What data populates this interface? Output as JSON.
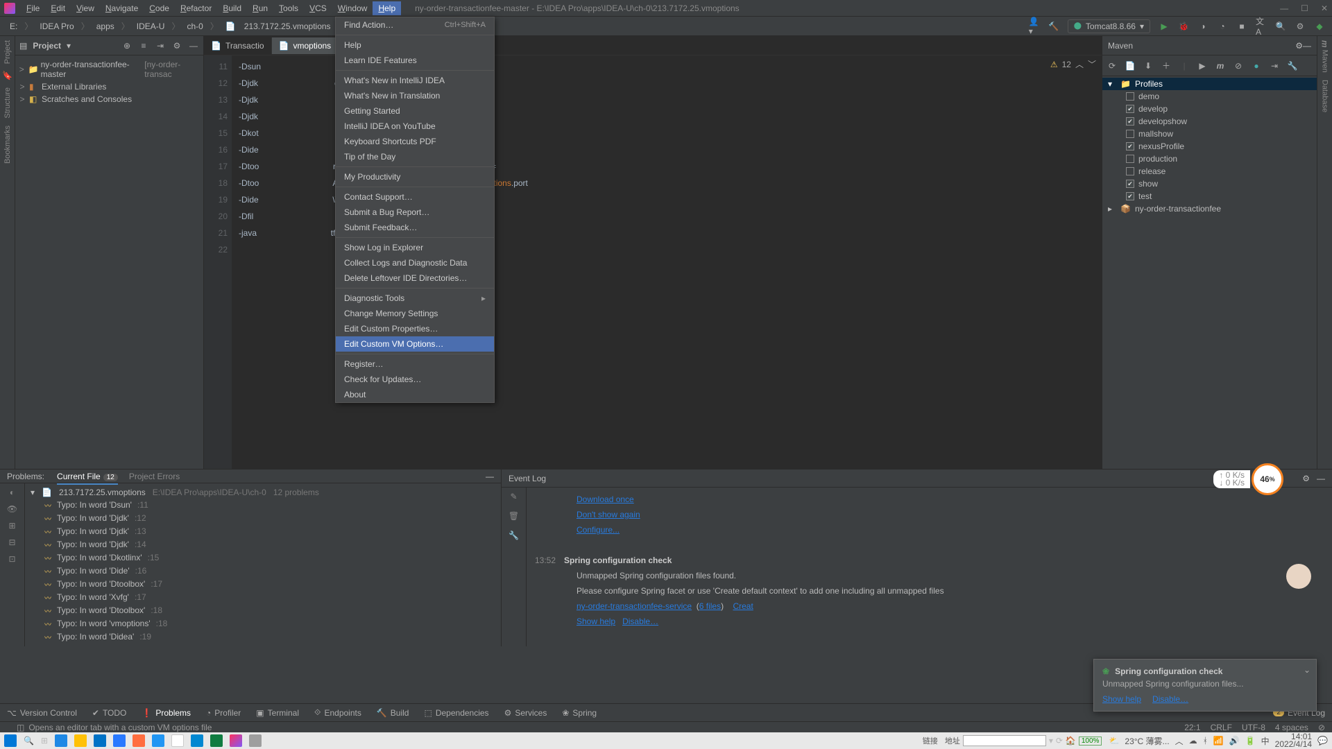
{
  "title_path": "ny-order-transactionfee-master - E:\\IDEA Pro\\apps\\IDEA-U\\ch-0\\213.7172.25.vmoptions",
  "menus": [
    "File",
    "Edit",
    "View",
    "Navigate",
    "Code",
    "Refactor",
    "Build",
    "Run",
    "Tools",
    "VCS",
    "Window",
    "Help"
  ],
  "active_menu": "Help",
  "breadcrumb": [
    "E:",
    "IDEA Pro",
    "apps",
    "IDEA-U",
    "ch-0",
    "213.7172.25.vmoptions"
  ],
  "run_config": "Tomcat8.8.66",
  "project": {
    "title": "Project",
    "nodes": [
      {
        "exp": ">",
        "icon": "📁",
        "cls": "orange",
        "text": "ny-order-transactionfee-master",
        "suffix": "[ny-order-transac"
      },
      {
        "exp": ">",
        "icon": "▮",
        "cls": "orange",
        "text": "External Libraries"
      },
      {
        "exp": ">",
        "icon": "◧",
        "cls": "yellow",
        "text": "Scratches and Consoles"
      }
    ]
  },
  "editor": {
    "tabs": [
      {
        "label": "Transactio",
        "active": false
      },
      {
        "label": "vmoptions",
        "active": true,
        "closable": true
      }
    ],
    "warn_count": "12",
    "lines": [
      {
        "n": 11,
        "t": "-Dsun"
      },
      {
        "n": 12,
        "t": "-Djdk                                 es=\"\""
      },
      {
        "n": 13,
        "t": "-Djdk"
      },
      {
        "n": 14,
        "t": "-Djdk"
      },
      {
        "n": 15,
        "t": "-Dkot"
      },
      {
        "n": 16,
        "t": "-Dide"
      },
      {
        "n": 17,
        "t": "-Dtoo                                rXvfgNrkVZ3MtIO-B7ICRHg1jG3yUMDaLg="
      },
      {
        "n": 18,
        "t": "-Dtoo                                A Pro\\apps\\IDEA-U\\ch-0\\213.7172.25.vmoptions.port",
        "hl": "vmoptions"
      },
      {
        "n": 19,
        "t": "-Dide                                \\\\IDEA-U\\\\ch-0\\\\213.7172.25.plugins"
      },
      {
        "n": 20,
        "t": "-Dfil"
      },
      {
        "n": 21,
        "t": "-java                                tfilter/ja-netfilter.jar"
      },
      {
        "n": 22,
        "t": ""
      }
    ]
  },
  "help_menu": [
    {
      "t": "Find Action…",
      "sc": "Ctrl+Shift+A"
    },
    {
      "sep": true
    },
    {
      "t": "Help"
    },
    {
      "t": "Learn IDE Features"
    },
    {
      "sep": true
    },
    {
      "t": "What's New in IntelliJ IDEA"
    },
    {
      "t": "What's New in Translation"
    },
    {
      "t": "Getting Started"
    },
    {
      "t": "IntelliJ IDEA on YouTube"
    },
    {
      "t": "Keyboard Shortcuts PDF"
    },
    {
      "t": "Tip of the Day"
    },
    {
      "sep": true
    },
    {
      "t": "My Productivity"
    },
    {
      "sep": true
    },
    {
      "t": "Contact Support…"
    },
    {
      "t": "Submit a Bug Report…"
    },
    {
      "t": "Submit Feedback…"
    },
    {
      "sep": true
    },
    {
      "t": "Show Log in Explorer"
    },
    {
      "t": "Collect Logs and Diagnostic Data"
    },
    {
      "t": "Delete Leftover IDE Directories…"
    },
    {
      "sep": true
    },
    {
      "t": "Diagnostic Tools",
      "arrow": true
    },
    {
      "t": "Change Memory Settings"
    },
    {
      "t": "Edit Custom Properties…"
    },
    {
      "t": "Edit Custom VM Options…",
      "sel": true
    },
    {
      "sep": true
    },
    {
      "t": "Register…"
    },
    {
      "t": "Check for Updates…"
    },
    {
      "t": "About"
    }
  ],
  "maven": {
    "title": "Maven",
    "profiles_label": "Profiles",
    "profiles": [
      {
        "n": "demo",
        "on": false
      },
      {
        "n": "develop",
        "on": true
      },
      {
        "n": "developshow",
        "on": true
      },
      {
        "n": "mallshow",
        "on": false
      },
      {
        "n": "nexusProfile",
        "on": true
      },
      {
        "n": "production",
        "on": false
      },
      {
        "n": "release",
        "on": false
      },
      {
        "n": "show",
        "on": true
      },
      {
        "n": "test",
        "on": true
      }
    ],
    "project": "ny-order-transactionfee"
  },
  "problems": {
    "title": "Problems:",
    "tabs": [
      {
        "l": "Current File",
        "c": "12",
        "act": true
      },
      {
        "l": "Project Errors"
      }
    ],
    "file": "213.7172.25.vmoptions",
    "path": "E:\\IDEA Pro\\apps\\IDEA-U\\ch-0",
    "count": "12 problems",
    "items": [
      {
        "t": "Typo: In word 'Dsun'",
        "p": ":11"
      },
      {
        "t": "Typo: In word 'Djdk'",
        "p": ":12"
      },
      {
        "t": "Typo: In word 'Djdk'",
        "p": ":13"
      },
      {
        "t": "Typo: In word 'Djdk'",
        "p": ":14"
      },
      {
        "t": "Typo: In word 'Dkotlinx'",
        "p": ":15"
      },
      {
        "t": "Typo: In word 'Dide'",
        "p": ":16"
      },
      {
        "t": "Typo: In word 'Dtoolbox'",
        "p": ":17"
      },
      {
        "t": "Typo: In word 'Xvfg'",
        "p": ":17"
      },
      {
        "t": "Typo: In word 'Dtoolbox'",
        "p": ":18"
      },
      {
        "t": "Typo: In word 'vmoptions'",
        "p": ":18"
      },
      {
        "t": "Typo: In word 'Didea'",
        "p": ":19"
      }
    ]
  },
  "eventlog": {
    "title": "Event Log",
    "links_top": [
      "Download once",
      "Don't show again",
      "Configure..."
    ],
    "entry": {
      "time": "13:52",
      "title": "Spring configuration check",
      "l1": "Unmapped Spring configuration files found.",
      "l2": "Please configure Spring facet or use 'Create default context' to add one including all unmapped files",
      "proj_link": "ny-order-transactionfee-service",
      "files": "(6 files)",
      "create": "Creat",
      "actions": [
        "Show help",
        "Disable…"
      ]
    }
  },
  "toast": {
    "title": "Spring configuration check",
    "msg": "Unmapped Spring configuration files...",
    "actions": [
      "Show help",
      "Disable…"
    ]
  },
  "toolwins": [
    {
      "i": "⌥",
      "l": "Version Control"
    },
    {
      "i": "✔",
      "l": "TODO"
    },
    {
      "i": "❗",
      "l": "Problems",
      "act": true
    },
    {
      "i": "◔",
      "l": "Profiler"
    },
    {
      "i": "▣",
      "l": "Terminal"
    },
    {
      "i": "⟐",
      "l": "Endpoints"
    },
    {
      "i": "🔨",
      "l": "Build"
    },
    {
      "i": "⬚",
      "l": "Dependencies"
    },
    {
      "i": "⚙",
      "l": "Services"
    },
    {
      "i": "❀",
      "l": "Spring"
    }
  ],
  "toolwin_right": {
    "l": "Event Log",
    "badge": "2"
  },
  "status_hint": "Opens an editor tab with a custom VM options file",
  "status_right": [
    "22:1",
    "CRLF",
    "UTF-8",
    "4 spaces",
    "⊘"
  ],
  "speed": "46",
  "speed_unit": "%",
  "net": {
    "up": "↑ 0 K/s",
    "dn": "↓ 0 K/s"
  },
  "taskbar": {
    "link_label": "链接",
    "addr_label": "地址",
    "zoom": "100%",
    "weather": "23°C 薄雾...",
    "time": "14:01",
    "date": "2022/4/14"
  }
}
